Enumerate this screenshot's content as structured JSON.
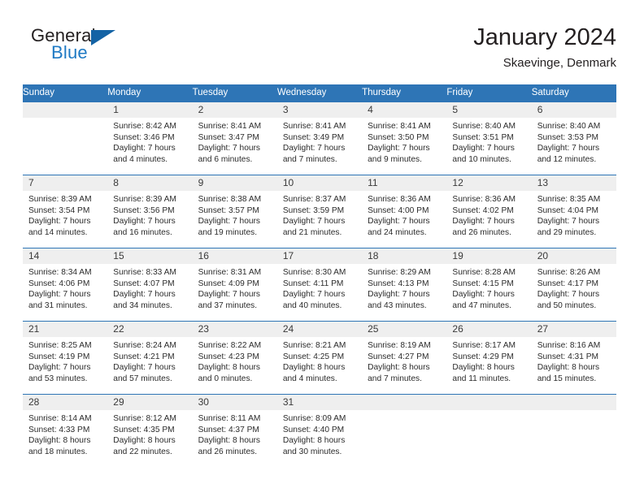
{
  "brand": {
    "line1": "General",
    "line2": "Blue",
    "logo_icon": "triangle-flag-icon",
    "colors": {
      "general": "#231f20",
      "blue": "#1f7ac4",
      "triangle": "#1463a5"
    }
  },
  "header": {
    "title": "January 2024",
    "subtitle": "Skaevinge, Denmark"
  },
  "theme": {
    "header_row_bg": "#2E75B6",
    "row_divider": "#2E75B6",
    "daynum_bg": "#efefef",
    "text": "#2b2b2b"
  },
  "calendar": {
    "weekday_headers": [
      "Sunday",
      "Monday",
      "Tuesday",
      "Wednesday",
      "Thursday",
      "Friday",
      "Saturday"
    ],
    "labels": {
      "sunrise": "Sunrise:",
      "sunset": "Sunset:",
      "daylight": "Daylight:"
    },
    "weeks": [
      [
        {
          "day": "",
          "empty": true,
          "sunrise": "",
          "sunset": "",
          "daylight_line1": "",
          "daylight_line2": ""
        },
        {
          "day": "1",
          "sunrise": "Sunrise: 8:42 AM",
          "sunset": "Sunset: 3:46 PM",
          "daylight_line1": "Daylight: 7 hours",
          "daylight_line2": "and 4 minutes."
        },
        {
          "day": "2",
          "sunrise": "Sunrise: 8:41 AM",
          "sunset": "Sunset: 3:47 PM",
          "daylight_line1": "Daylight: 7 hours",
          "daylight_line2": "and 6 minutes."
        },
        {
          "day": "3",
          "sunrise": "Sunrise: 8:41 AM",
          "sunset": "Sunset: 3:49 PM",
          "daylight_line1": "Daylight: 7 hours",
          "daylight_line2": "and 7 minutes."
        },
        {
          "day": "4",
          "sunrise": "Sunrise: 8:41 AM",
          "sunset": "Sunset: 3:50 PM",
          "daylight_line1": "Daylight: 7 hours",
          "daylight_line2": "and 9 minutes."
        },
        {
          "day": "5",
          "sunrise": "Sunrise: 8:40 AM",
          "sunset": "Sunset: 3:51 PM",
          "daylight_line1": "Daylight: 7 hours",
          "daylight_line2": "and 10 minutes."
        },
        {
          "day": "6",
          "sunrise": "Sunrise: 8:40 AM",
          "sunset": "Sunset: 3:53 PM",
          "daylight_line1": "Daylight: 7 hours",
          "daylight_line2": "and 12 minutes."
        }
      ],
      [
        {
          "day": "7",
          "sunrise": "Sunrise: 8:39 AM",
          "sunset": "Sunset: 3:54 PM",
          "daylight_line1": "Daylight: 7 hours",
          "daylight_line2": "and 14 minutes."
        },
        {
          "day": "8",
          "sunrise": "Sunrise: 8:39 AM",
          "sunset": "Sunset: 3:56 PM",
          "daylight_line1": "Daylight: 7 hours",
          "daylight_line2": "and 16 minutes."
        },
        {
          "day": "9",
          "sunrise": "Sunrise: 8:38 AM",
          "sunset": "Sunset: 3:57 PM",
          "daylight_line1": "Daylight: 7 hours",
          "daylight_line2": "and 19 minutes."
        },
        {
          "day": "10",
          "sunrise": "Sunrise: 8:37 AM",
          "sunset": "Sunset: 3:59 PM",
          "daylight_line1": "Daylight: 7 hours",
          "daylight_line2": "and 21 minutes."
        },
        {
          "day": "11",
          "sunrise": "Sunrise: 8:36 AM",
          "sunset": "Sunset: 4:00 PM",
          "daylight_line1": "Daylight: 7 hours",
          "daylight_line2": "and 24 minutes."
        },
        {
          "day": "12",
          "sunrise": "Sunrise: 8:36 AM",
          "sunset": "Sunset: 4:02 PM",
          "daylight_line1": "Daylight: 7 hours",
          "daylight_line2": "and 26 minutes."
        },
        {
          "day": "13",
          "sunrise": "Sunrise: 8:35 AM",
          "sunset": "Sunset: 4:04 PM",
          "daylight_line1": "Daylight: 7 hours",
          "daylight_line2": "and 29 minutes."
        }
      ],
      [
        {
          "day": "14",
          "sunrise": "Sunrise: 8:34 AM",
          "sunset": "Sunset: 4:06 PM",
          "daylight_line1": "Daylight: 7 hours",
          "daylight_line2": "and 31 minutes."
        },
        {
          "day": "15",
          "sunrise": "Sunrise: 8:33 AM",
          "sunset": "Sunset: 4:07 PM",
          "daylight_line1": "Daylight: 7 hours",
          "daylight_line2": "and 34 minutes."
        },
        {
          "day": "16",
          "sunrise": "Sunrise: 8:31 AM",
          "sunset": "Sunset: 4:09 PM",
          "daylight_line1": "Daylight: 7 hours",
          "daylight_line2": "and 37 minutes."
        },
        {
          "day": "17",
          "sunrise": "Sunrise: 8:30 AM",
          "sunset": "Sunset: 4:11 PM",
          "daylight_line1": "Daylight: 7 hours",
          "daylight_line2": "and 40 minutes."
        },
        {
          "day": "18",
          "sunrise": "Sunrise: 8:29 AM",
          "sunset": "Sunset: 4:13 PM",
          "daylight_line1": "Daylight: 7 hours",
          "daylight_line2": "and 43 minutes."
        },
        {
          "day": "19",
          "sunrise": "Sunrise: 8:28 AM",
          "sunset": "Sunset: 4:15 PM",
          "daylight_line1": "Daylight: 7 hours",
          "daylight_line2": "and 47 minutes."
        },
        {
          "day": "20",
          "sunrise": "Sunrise: 8:26 AM",
          "sunset": "Sunset: 4:17 PM",
          "daylight_line1": "Daylight: 7 hours",
          "daylight_line2": "and 50 minutes."
        }
      ],
      [
        {
          "day": "21",
          "sunrise": "Sunrise: 8:25 AM",
          "sunset": "Sunset: 4:19 PM",
          "daylight_line1": "Daylight: 7 hours",
          "daylight_line2": "and 53 minutes."
        },
        {
          "day": "22",
          "sunrise": "Sunrise: 8:24 AM",
          "sunset": "Sunset: 4:21 PM",
          "daylight_line1": "Daylight: 7 hours",
          "daylight_line2": "and 57 minutes."
        },
        {
          "day": "23",
          "sunrise": "Sunrise: 8:22 AM",
          "sunset": "Sunset: 4:23 PM",
          "daylight_line1": "Daylight: 8 hours",
          "daylight_line2": "and 0 minutes."
        },
        {
          "day": "24",
          "sunrise": "Sunrise: 8:21 AM",
          "sunset": "Sunset: 4:25 PM",
          "daylight_line1": "Daylight: 8 hours",
          "daylight_line2": "and 4 minutes."
        },
        {
          "day": "25",
          "sunrise": "Sunrise: 8:19 AM",
          "sunset": "Sunset: 4:27 PM",
          "daylight_line1": "Daylight: 8 hours",
          "daylight_line2": "and 7 minutes."
        },
        {
          "day": "26",
          "sunrise": "Sunrise: 8:17 AM",
          "sunset": "Sunset: 4:29 PM",
          "daylight_line1": "Daylight: 8 hours",
          "daylight_line2": "and 11 minutes."
        },
        {
          "day": "27",
          "sunrise": "Sunrise: 8:16 AM",
          "sunset": "Sunset: 4:31 PM",
          "daylight_line1": "Daylight: 8 hours",
          "daylight_line2": "and 15 minutes."
        }
      ],
      [
        {
          "day": "28",
          "sunrise": "Sunrise: 8:14 AM",
          "sunset": "Sunset: 4:33 PM",
          "daylight_line1": "Daylight: 8 hours",
          "daylight_line2": "and 18 minutes."
        },
        {
          "day": "29",
          "sunrise": "Sunrise: 8:12 AM",
          "sunset": "Sunset: 4:35 PM",
          "daylight_line1": "Daylight: 8 hours",
          "daylight_line2": "and 22 minutes."
        },
        {
          "day": "30",
          "sunrise": "Sunrise: 8:11 AM",
          "sunset": "Sunset: 4:37 PM",
          "daylight_line1": "Daylight: 8 hours",
          "daylight_line2": "and 26 minutes."
        },
        {
          "day": "31",
          "sunrise": "Sunrise: 8:09 AM",
          "sunset": "Sunset: 4:40 PM",
          "daylight_line1": "Daylight: 8 hours",
          "daylight_line2": "and 30 minutes."
        },
        {
          "day": "",
          "empty": true,
          "sunrise": "",
          "sunset": "",
          "daylight_line1": "",
          "daylight_line2": ""
        },
        {
          "day": "",
          "empty": true,
          "sunrise": "",
          "sunset": "",
          "daylight_line1": "",
          "daylight_line2": ""
        },
        {
          "day": "",
          "empty": true,
          "sunrise": "",
          "sunset": "",
          "daylight_line1": "",
          "daylight_line2": ""
        }
      ]
    ]
  }
}
